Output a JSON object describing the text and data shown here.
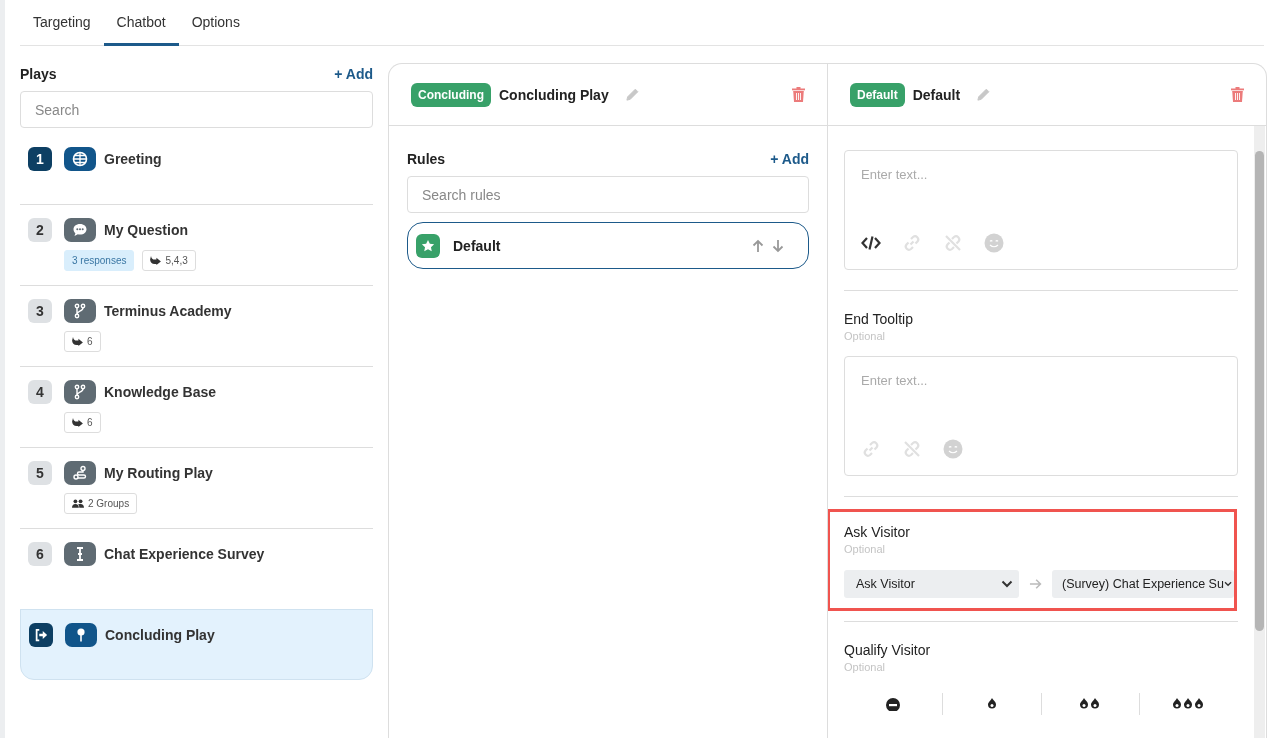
{
  "tabs": [
    {
      "label": "Targeting",
      "selected": false
    },
    {
      "label": "Chatbot",
      "selected": true
    },
    {
      "label": "Options",
      "selected": false
    }
  ],
  "plays": {
    "title": "Plays",
    "add": "+ Add",
    "search_placeholder": "Search",
    "items": [
      {
        "number": "1",
        "name": "Greeting",
        "kind": "greeting",
        "selected": false
      },
      {
        "number": "2",
        "name": "My Question",
        "kind": "question",
        "selected": false,
        "tags": [
          {
            "kind": "responses",
            "text": "3 responses"
          },
          {
            "kind": "route",
            "text": "5,4,3"
          }
        ]
      },
      {
        "number": "3",
        "name": "Terminus Academy",
        "kind": "branch",
        "selected": false,
        "tags": [
          {
            "kind": "route",
            "text": "6"
          }
        ]
      },
      {
        "number": "4",
        "name": "Knowledge Base",
        "kind": "branch",
        "selected": false,
        "tags": [
          {
            "kind": "route",
            "text": "6"
          }
        ]
      },
      {
        "number": "5",
        "name": "My Routing Play",
        "kind": "routing",
        "selected": false,
        "tags": [
          {
            "kind": "groups",
            "text": "2 Groups"
          }
        ]
      },
      {
        "number": "6",
        "name": "Chat Experience Survey",
        "kind": "survey",
        "selected": false
      },
      {
        "name": "Concluding Play",
        "kind": "concluding",
        "selected": true
      }
    ]
  },
  "play_panel": {
    "badge": "Concluding",
    "title": "Concluding Play",
    "rules": {
      "title": "Rules",
      "add": "+ Add",
      "search_placeholder": "Search rules",
      "items": [
        {
          "name": "Default",
          "selected": true
        }
      ]
    }
  },
  "rule_panel": {
    "badge": "Default",
    "title": "Default",
    "sections": [
      {
        "kind": "editor",
        "placeholder": "Enter text...",
        "tools": [
          {
            "kind": "code",
            "disabled": false
          },
          {
            "kind": "link",
            "disabled": true
          },
          {
            "kind": "unlink",
            "disabled": true
          },
          {
            "kind": "emoji",
            "disabled": true
          }
        ]
      },
      {
        "kind": "editor",
        "title": "End Tooltip",
        "hint": "Optional",
        "placeholder": "Enter text...",
        "tools": [
          {
            "kind": "link",
            "disabled": true
          },
          {
            "kind": "unlink",
            "disabled": true
          },
          {
            "kind": "emoji",
            "disabled": true
          }
        ]
      },
      {
        "kind": "ask",
        "title": "Ask Visitor",
        "hint": "Optional",
        "highlighted": true,
        "selects": [
          "Ask Visitor",
          "(Survey) Chat Experience Su"
        ]
      },
      {
        "kind": "qualify",
        "title": "Qualify Visitor",
        "hint": "Optional"
      }
    ]
  }
}
